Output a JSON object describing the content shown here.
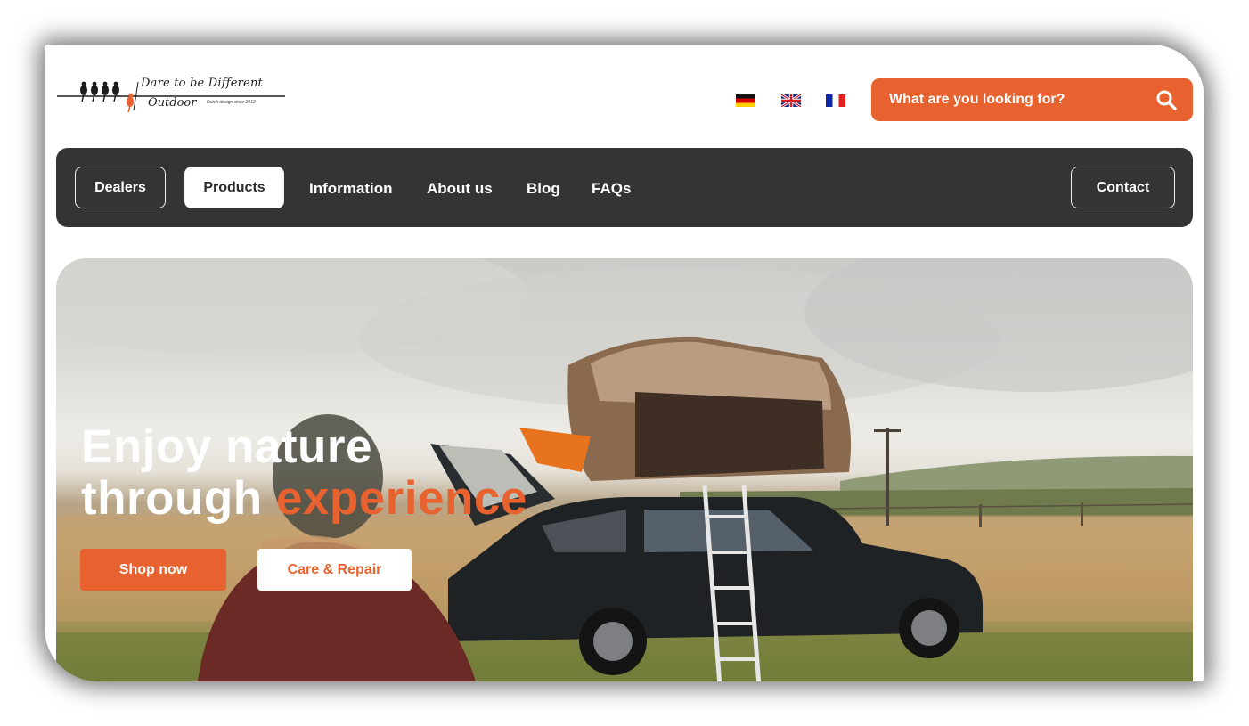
{
  "brand": {
    "tagline": "Dare to be Different",
    "name": "Outdoor",
    "subtag": "Dutch design since 2012"
  },
  "languages": [
    {
      "name": "German flag"
    },
    {
      "name": "UK flag"
    },
    {
      "name": "French flag"
    }
  ],
  "search": {
    "placeholder": "What are you looking for?",
    "icon": "search-icon"
  },
  "nav": {
    "dealers": "Dealers",
    "products": "Products",
    "information": "Information",
    "about": "About us",
    "blog": "Blog",
    "faqs": "FAQs",
    "contact": "Contact",
    "active": "Products"
  },
  "hero": {
    "title_line1": "Enjoy nature",
    "title_line2_plain": "through ",
    "title_line2_accent": "experience",
    "primary_cta": "Shop now",
    "secondary_cta": "Care & Repair"
  },
  "colors": {
    "accent": "#e8622f",
    "nav_bg": "#343434",
    "white": "#ffffff"
  }
}
